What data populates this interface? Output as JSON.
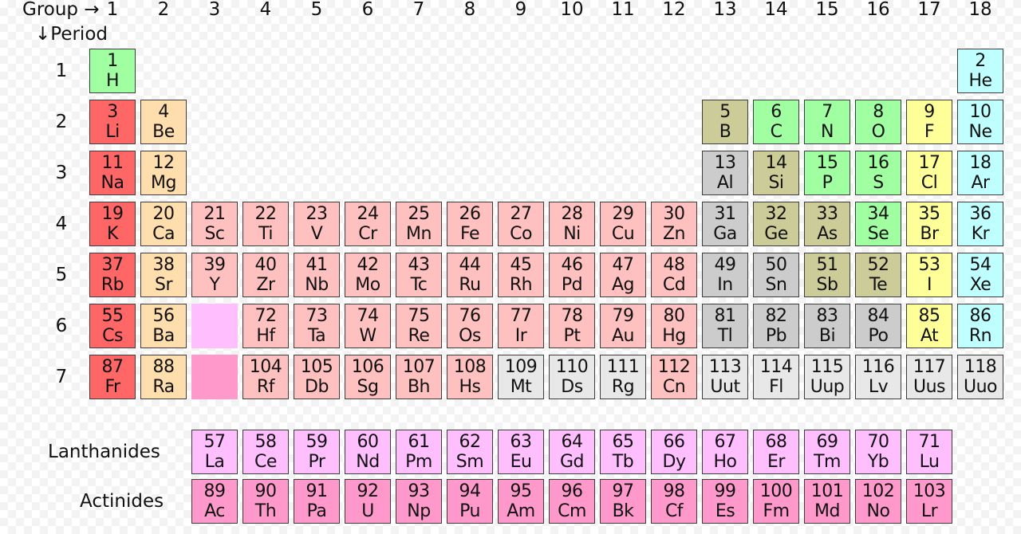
{
  "header": {
    "group_label": "Group →",
    "period_label": "↓Period",
    "groups": [
      "1",
      "2",
      "3",
      "4",
      "5",
      "6",
      "7",
      "8",
      "9",
      "10",
      "11",
      "12",
      "13",
      "14",
      "15",
      "16",
      "17",
      "18"
    ],
    "periods": [
      "1",
      "2",
      "3",
      "4",
      "5",
      "6",
      "7"
    ]
  },
  "series_labels": {
    "lanthanides": "Lanthanides",
    "actinides": "Actinides"
  },
  "colors": {
    "alkali": "#ff6666",
    "alkaline": "#ffdead",
    "transition": "#ffc0c0",
    "post": "#cccccc",
    "metalloid": "#cccc99",
    "nonmetal": "#a0ffa0",
    "halogen": "#ffff99",
    "noble": "#c0ffff",
    "lanthanide": "#ffbfff",
    "actinide": "#ff99cc",
    "unknown": "#e8e8e8"
  },
  "elements": [
    {
      "n": "1",
      "s": "H",
      "g": 1,
      "p": 1,
      "c": "nonmetal"
    },
    {
      "n": "2",
      "s": "He",
      "g": 18,
      "p": 1,
      "c": "noble"
    },
    {
      "n": "3",
      "s": "Li",
      "g": 1,
      "p": 2,
      "c": "alkali"
    },
    {
      "n": "4",
      "s": "Be",
      "g": 2,
      "p": 2,
      "c": "alkaline"
    },
    {
      "n": "5",
      "s": "B",
      "g": 13,
      "p": 2,
      "c": "metalloid"
    },
    {
      "n": "6",
      "s": "C",
      "g": 14,
      "p": 2,
      "c": "nonmetal"
    },
    {
      "n": "7",
      "s": "N",
      "g": 15,
      "p": 2,
      "c": "nonmetal"
    },
    {
      "n": "8",
      "s": "O",
      "g": 16,
      "p": 2,
      "c": "nonmetal"
    },
    {
      "n": "9",
      "s": "F",
      "g": 17,
      "p": 2,
      "c": "halogen"
    },
    {
      "n": "10",
      "s": "Ne",
      "g": 18,
      "p": 2,
      "c": "noble"
    },
    {
      "n": "11",
      "s": "Na",
      "g": 1,
      "p": 3,
      "c": "alkali"
    },
    {
      "n": "12",
      "s": "Mg",
      "g": 2,
      "p": 3,
      "c": "alkaline"
    },
    {
      "n": "13",
      "s": "Al",
      "g": 13,
      "p": 3,
      "c": "post"
    },
    {
      "n": "14",
      "s": "Si",
      "g": 14,
      "p": 3,
      "c": "metalloid"
    },
    {
      "n": "15",
      "s": "P",
      "g": 15,
      "p": 3,
      "c": "nonmetal"
    },
    {
      "n": "16",
      "s": "S",
      "g": 16,
      "p": 3,
      "c": "nonmetal"
    },
    {
      "n": "17",
      "s": "Cl",
      "g": 17,
      "p": 3,
      "c": "halogen"
    },
    {
      "n": "18",
      "s": "Ar",
      "g": 18,
      "p": 3,
      "c": "noble"
    },
    {
      "n": "19",
      "s": "K",
      "g": 1,
      "p": 4,
      "c": "alkali"
    },
    {
      "n": "20",
      "s": "Ca",
      "g": 2,
      "p": 4,
      "c": "alkaline"
    },
    {
      "n": "21",
      "s": "Sc",
      "g": 3,
      "p": 4,
      "c": "transition"
    },
    {
      "n": "22",
      "s": "Ti",
      "g": 4,
      "p": 4,
      "c": "transition"
    },
    {
      "n": "23",
      "s": "V",
      "g": 5,
      "p": 4,
      "c": "transition"
    },
    {
      "n": "24",
      "s": "Cr",
      "g": 6,
      "p": 4,
      "c": "transition"
    },
    {
      "n": "25",
      "s": "Mn",
      "g": 7,
      "p": 4,
      "c": "transition"
    },
    {
      "n": "26",
      "s": "Fe",
      "g": 8,
      "p": 4,
      "c": "transition"
    },
    {
      "n": "27",
      "s": "Co",
      "g": 9,
      "p": 4,
      "c": "transition"
    },
    {
      "n": "28",
      "s": "Ni",
      "g": 10,
      "p": 4,
      "c": "transition"
    },
    {
      "n": "29",
      "s": "Cu",
      "g": 11,
      "p": 4,
      "c": "transition"
    },
    {
      "n": "30",
      "s": "Zn",
      "g": 12,
      "p": 4,
      "c": "transition"
    },
    {
      "n": "31",
      "s": "Ga",
      "g": 13,
      "p": 4,
      "c": "post"
    },
    {
      "n": "32",
      "s": "Ge",
      "g": 14,
      "p": 4,
      "c": "metalloid"
    },
    {
      "n": "33",
      "s": "As",
      "g": 15,
      "p": 4,
      "c": "metalloid"
    },
    {
      "n": "34",
      "s": "Se",
      "g": 16,
      "p": 4,
      "c": "nonmetal"
    },
    {
      "n": "35",
      "s": "Br",
      "g": 17,
      "p": 4,
      "c": "halogen"
    },
    {
      "n": "36",
      "s": "Kr",
      "g": 18,
      "p": 4,
      "c": "noble"
    },
    {
      "n": "37",
      "s": "Rb",
      "g": 1,
      "p": 5,
      "c": "alkali"
    },
    {
      "n": "38",
      "s": "Sr",
      "g": 2,
      "p": 5,
      "c": "alkaline"
    },
    {
      "n": "39",
      "s": "Y",
      "g": 3,
      "p": 5,
      "c": "transition"
    },
    {
      "n": "40",
      "s": "Zr",
      "g": 4,
      "p": 5,
      "c": "transition"
    },
    {
      "n": "41",
      "s": "Nb",
      "g": 5,
      "p": 5,
      "c": "transition"
    },
    {
      "n": "42",
      "s": "Mo",
      "g": 6,
      "p": 5,
      "c": "transition"
    },
    {
      "n": "43",
      "s": "Tc",
      "g": 7,
      "p": 5,
      "c": "transition"
    },
    {
      "n": "44",
      "s": "Ru",
      "g": 8,
      "p": 5,
      "c": "transition"
    },
    {
      "n": "45",
      "s": "Rh",
      "g": 9,
      "p": 5,
      "c": "transition"
    },
    {
      "n": "46",
      "s": "Pd",
      "g": 10,
      "p": 5,
      "c": "transition"
    },
    {
      "n": "47",
      "s": "Ag",
      "g": 11,
      "p": 5,
      "c": "transition"
    },
    {
      "n": "48",
      "s": "Cd",
      "g": 12,
      "p": 5,
      "c": "transition"
    },
    {
      "n": "49",
      "s": "In",
      "g": 13,
      "p": 5,
      "c": "post"
    },
    {
      "n": "50",
      "s": "Sn",
      "g": 14,
      "p": 5,
      "c": "post"
    },
    {
      "n": "51",
      "s": "Sb",
      "g": 15,
      "p": 5,
      "c": "metalloid"
    },
    {
      "n": "52",
      "s": "Te",
      "g": 16,
      "p": 5,
      "c": "metalloid"
    },
    {
      "n": "53",
      "s": "I",
      "g": 17,
      "p": 5,
      "c": "halogen"
    },
    {
      "n": "54",
      "s": "Xe",
      "g": 18,
      "p": 5,
      "c": "noble"
    },
    {
      "n": "55",
      "s": "Cs",
      "g": 1,
      "p": 6,
      "c": "alkali"
    },
    {
      "n": "56",
      "s": "Ba",
      "g": 2,
      "p": 6,
      "c": "alkaline"
    },
    {
      "n": "",
      "s": "",
      "g": 3,
      "p": 6,
      "c": "lanthanide",
      "empty": true
    },
    {
      "n": "72",
      "s": "Hf",
      "g": 4,
      "p": 6,
      "c": "transition"
    },
    {
      "n": "73",
      "s": "Ta",
      "g": 5,
      "p": 6,
      "c": "transition"
    },
    {
      "n": "74",
      "s": "W",
      "g": 6,
      "p": 6,
      "c": "transition"
    },
    {
      "n": "75",
      "s": "Re",
      "g": 7,
      "p": 6,
      "c": "transition"
    },
    {
      "n": "76",
      "s": "Os",
      "g": 8,
      "p": 6,
      "c": "transition"
    },
    {
      "n": "77",
      "s": "Ir",
      "g": 9,
      "p": 6,
      "c": "transition"
    },
    {
      "n": "78",
      "s": "Pt",
      "g": 10,
      "p": 6,
      "c": "transition"
    },
    {
      "n": "79",
      "s": "Au",
      "g": 11,
      "p": 6,
      "c": "transition"
    },
    {
      "n": "80",
      "s": "Hg",
      "g": 12,
      "p": 6,
      "c": "transition"
    },
    {
      "n": "81",
      "s": "Tl",
      "g": 13,
      "p": 6,
      "c": "post"
    },
    {
      "n": "82",
      "s": "Pb",
      "g": 14,
      "p": 6,
      "c": "post"
    },
    {
      "n": "83",
      "s": "Bi",
      "g": 15,
      "p": 6,
      "c": "post"
    },
    {
      "n": "84",
      "s": "Po",
      "g": 16,
      "p": 6,
      "c": "post"
    },
    {
      "n": "85",
      "s": "At",
      "g": 17,
      "p": 6,
      "c": "halogen"
    },
    {
      "n": "86",
      "s": "Rn",
      "g": 18,
      "p": 6,
      "c": "noble"
    },
    {
      "n": "87",
      "s": "Fr",
      "g": 1,
      "p": 7,
      "c": "alkali"
    },
    {
      "n": "88",
      "s": "Ra",
      "g": 2,
      "p": 7,
      "c": "alkaline"
    },
    {
      "n": "",
      "s": "",
      "g": 3,
      "p": 7,
      "c": "actinide",
      "empty": true
    },
    {
      "n": "104",
      "s": "Rf",
      "g": 4,
      "p": 7,
      "c": "transition"
    },
    {
      "n": "105",
      "s": "Db",
      "g": 5,
      "p": 7,
      "c": "transition"
    },
    {
      "n": "106",
      "s": "Sg",
      "g": 6,
      "p": 7,
      "c": "transition"
    },
    {
      "n": "107",
      "s": "Bh",
      "g": 7,
      "p": 7,
      "c": "transition"
    },
    {
      "n": "108",
      "s": "Hs",
      "g": 8,
      "p": 7,
      "c": "transition"
    },
    {
      "n": "109",
      "s": "Mt",
      "g": 9,
      "p": 7,
      "c": "unknown"
    },
    {
      "n": "110",
      "s": "Ds",
      "g": 10,
      "p": 7,
      "c": "unknown"
    },
    {
      "n": "111",
      "s": "Rg",
      "g": 11,
      "p": 7,
      "c": "unknown"
    },
    {
      "n": "112",
      "s": "Cn",
      "g": 12,
      "p": 7,
      "c": "transition"
    },
    {
      "n": "113",
      "s": "Uut",
      "g": 13,
      "p": 7,
      "c": "unknown"
    },
    {
      "n": "114",
      "s": "Fl",
      "g": 14,
      "p": 7,
      "c": "unknown"
    },
    {
      "n": "115",
      "s": "Uup",
      "g": 15,
      "p": 7,
      "c": "unknown"
    },
    {
      "n": "116",
      "s": "Lv",
      "g": 16,
      "p": 7,
      "c": "unknown"
    },
    {
      "n": "117",
      "s": "Uus",
      "g": 17,
      "p": 7,
      "c": "unknown"
    },
    {
      "n": "118",
      "s": "Uuo",
      "g": 18,
      "p": 7,
      "c": "unknown"
    },
    {
      "n": "57",
      "s": "La",
      "g": 3,
      "p": 9,
      "c": "lanthanide"
    },
    {
      "n": "58",
      "s": "Ce",
      "g": 4,
      "p": 9,
      "c": "lanthanide"
    },
    {
      "n": "59",
      "s": "Pr",
      "g": 5,
      "p": 9,
      "c": "lanthanide"
    },
    {
      "n": "60",
      "s": "Nd",
      "g": 6,
      "p": 9,
      "c": "lanthanide"
    },
    {
      "n": "61",
      "s": "Pm",
      "g": 7,
      "p": 9,
      "c": "lanthanide"
    },
    {
      "n": "62",
      "s": "Sm",
      "g": 8,
      "p": 9,
      "c": "lanthanide"
    },
    {
      "n": "63",
      "s": "Eu",
      "g": 9,
      "p": 9,
      "c": "lanthanide"
    },
    {
      "n": "64",
      "s": "Gd",
      "g": 10,
      "p": 9,
      "c": "lanthanide"
    },
    {
      "n": "65",
      "s": "Tb",
      "g": 11,
      "p": 9,
      "c": "lanthanide"
    },
    {
      "n": "66",
      "s": "Dy",
      "g": 12,
      "p": 9,
      "c": "lanthanide"
    },
    {
      "n": "67",
      "s": "Ho",
      "g": 13,
      "p": 9,
      "c": "lanthanide"
    },
    {
      "n": "68",
      "s": "Er",
      "g": 14,
      "p": 9,
      "c": "lanthanide"
    },
    {
      "n": "69",
      "s": "Tm",
      "g": 15,
      "p": 9,
      "c": "lanthanide"
    },
    {
      "n": "70",
      "s": "Yb",
      "g": 16,
      "p": 9,
      "c": "lanthanide"
    },
    {
      "n": "71",
      "s": "Lu",
      "g": 17,
      "p": 9,
      "c": "lanthanide"
    },
    {
      "n": "89",
      "s": "Ac",
      "g": 3,
      "p": 10,
      "c": "actinide"
    },
    {
      "n": "90",
      "s": "Th",
      "g": 4,
      "p": 10,
      "c": "actinide"
    },
    {
      "n": "91",
      "s": "Pa",
      "g": 5,
      "p": 10,
      "c": "actinide"
    },
    {
      "n": "92",
      "s": "U",
      "g": 6,
      "p": 10,
      "c": "actinide"
    },
    {
      "n": "93",
      "s": "Np",
      "g": 7,
      "p": 10,
      "c": "actinide"
    },
    {
      "n": "94",
      "s": "Pu",
      "g": 8,
      "p": 10,
      "c": "actinide"
    },
    {
      "n": "95",
      "s": "Am",
      "g": 9,
      "p": 10,
      "c": "actinide"
    },
    {
      "n": "96",
      "s": "Cm",
      "g": 10,
      "p": 10,
      "c": "actinide"
    },
    {
      "n": "97",
      "s": "Bk",
      "g": 11,
      "p": 10,
      "c": "actinide"
    },
    {
      "n": "98",
      "s": "Cf",
      "g": 12,
      "p": 10,
      "c": "actinide"
    },
    {
      "n": "99",
      "s": "Es",
      "g": 13,
      "p": 10,
      "c": "actinide"
    },
    {
      "n": "100",
      "s": "Fm",
      "g": 14,
      "p": 10,
      "c": "actinide"
    },
    {
      "n": "101",
      "s": "Md",
      "g": 15,
      "p": 10,
      "c": "actinide"
    },
    {
      "n": "102",
      "s": "No",
      "g": 16,
      "p": 10,
      "c": "actinide"
    },
    {
      "n": "103",
      "s": "Lr",
      "g": 17,
      "p": 10,
      "c": "actinide"
    }
  ]
}
